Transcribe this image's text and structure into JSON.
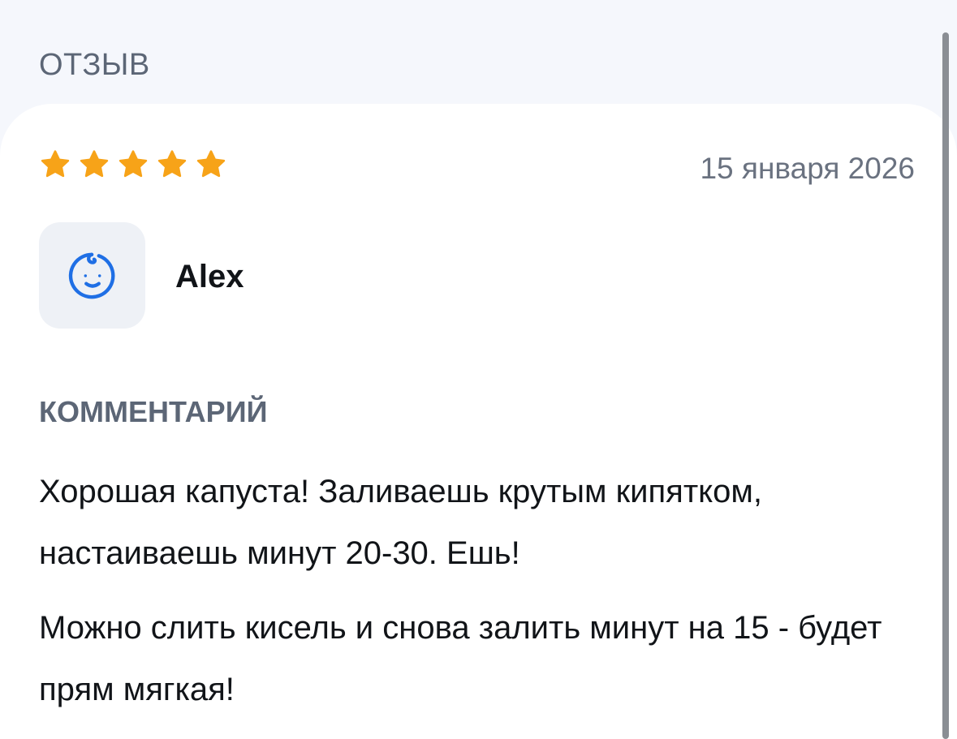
{
  "header": {
    "title": "ОТЗЫВ"
  },
  "review": {
    "rating": 5,
    "max_rating": 5,
    "star_color": "#f7a318",
    "date": "15 января 2026",
    "author": {
      "name": "Alex",
      "avatar_icon": "baby-face-icon",
      "avatar_color": "#1f6fe5"
    },
    "comment_label": "КОММЕНТАРИЙ",
    "comment_paragraphs": [
      "Хорошая капуста! Заливаешь крутым кипятком, настаиваешь минут 20-30. Ешь!",
      "Можно слить кисель и снова залить минут на 15 - будет прям мягкая!"
    ]
  }
}
